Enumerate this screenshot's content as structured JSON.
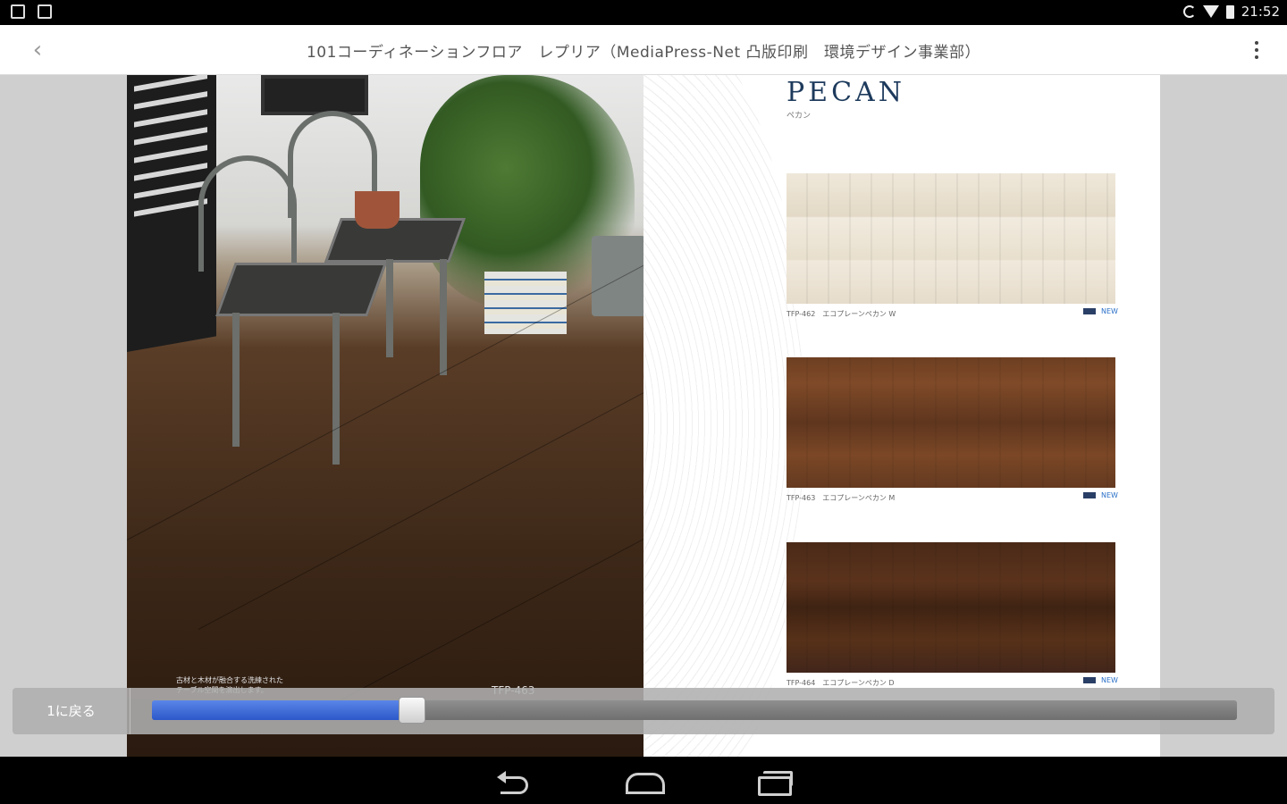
{
  "status_bar": {
    "time": "21:52",
    "left_icons": [
      "gallery-icon",
      "clipboard-icon"
    ],
    "right_icons": [
      "screen-rotation-icon",
      "wifi-icon",
      "battery-icon"
    ]
  },
  "app_bar": {
    "back_glyph": "‹",
    "title": "101コーディネーションフロア　レプリア（MediaPress-Net 凸版印刷　環境デザイン事業部）",
    "overflow_icon": "more-vert-icon"
  },
  "viewer": {
    "left_page": {
      "caption": "古材と木材が融合する洗練された\nテーブル空間を演出します。",
      "product_code": "TFP-463"
    },
    "right_page": {
      "brand": "PECAN",
      "brand_reading": "ペカン",
      "swatches": [
        {
          "caption": "TFP-462　エコプレーンペカン W",
          "badge": "NEW",
          "color": "#ebe3d3"
        },
        {
          "caption": "TFP-463　エコプレーンペカン M",
          "badge": "NEW",
          "color": "#6e3f22"
        },
        {
          "caption": "TFP-464　エコプレーンペカン D",
          "badge": "NEW",
          "color": "#4a2a18"
        }
      ]
    }
  },
  "page_slider": {
    "return_label": "1に戻る",
    "progress_fraction": 0.24,
    "accent": "#2d58c9"
  },
  "nav_bar": {
    "icons": [
      "back-icon",
      "home-icon",
      "recents-icon"
    ]
  }
}
